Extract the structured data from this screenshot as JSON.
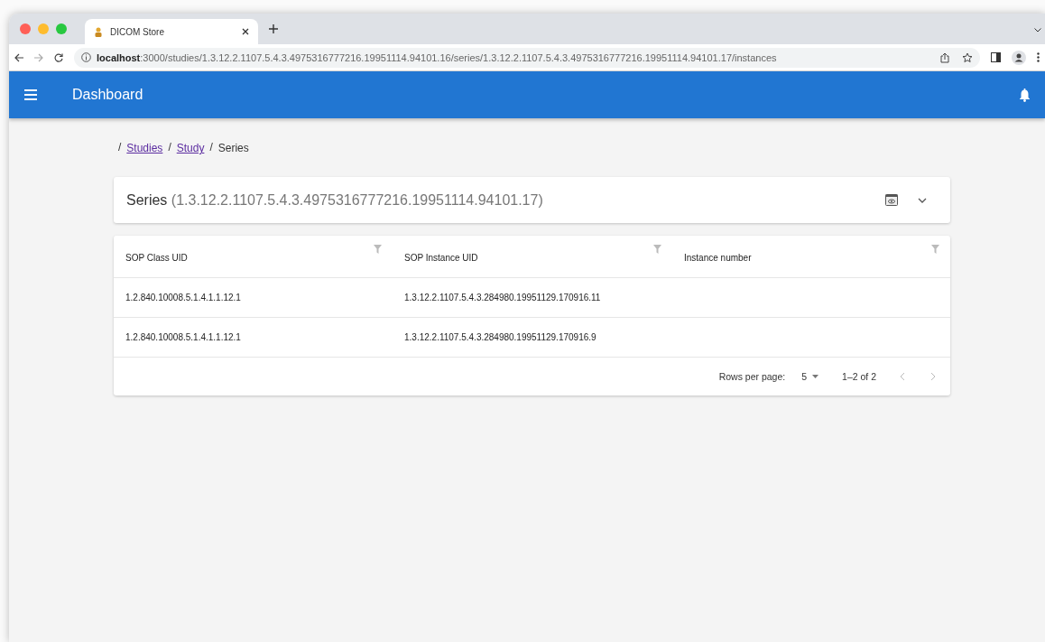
{
  "browser": {
    "tab_title": "DICOM Store",
    "url_host": "localhost",
    "url_rest": ":3000/studies/1.3.12.2.1107.5.4.3.4975316777216.19951114.94101.16/series/1.3.12.2.1107.5.4.3.4975316777216.19951114.94101.17/instances"
  },
  "app_bar": {
    "title": "Dashboard"
  },
  "breadcrumbs": [
    {
      "separator": "/",
      "label": "Studies",
      "kind": "link"
    },
    {
      "separator": "/",
      "label": "Study",
      "kind": "link"
    },
    {
      "separator": "/",
      "label": "Series",
      "kind": "current"
    }
  ],
  "series_card": {
    "title": "Series",
    "uid": "(1.3.12.2.1107.5.4.3.4975316777216.19951114.94101.17)",
    "expanded": false
  },
  "table": {
    "columns": [
      "SOP Class UID",
      "SOP Instance UID",
      "Instance number"
    ],
    "rows": [
      [
        "1.2.840.10008.5.1.4.1.1.12.1",
        "1.3.12.2.1107.5.4.3.284980.19951129.170916.11"
      ],
      [
        "1.2.840.10008.5.1.4.1.1.12.1",
        "1.3.12.2.1107.5.4.3.284980.19951129.170916.9"
      ]
    ],
    "pagination": {
      "rows_per_page_label": "Rows per page:",
      "rows_per_page": "5",
      "range": "1–2 of 2"
    }
  }
}
